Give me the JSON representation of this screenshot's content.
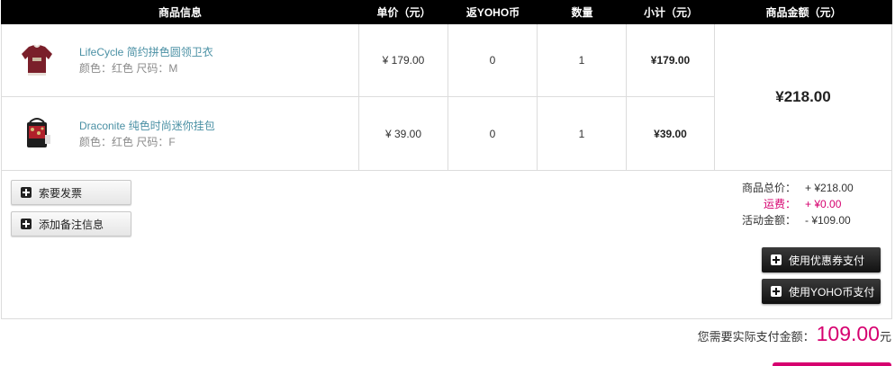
{
  "header": {
    "info": "商品信息",
    "price": "单价（元）",
    "coin": "返YOHO币",
    "qty": "数量",
    "subtotal": "小计（元）",
    "amount": "商品金额（元）"
  },
  "items": [
    {
      "title": "LifeCycle 简约拼色圆领卫衣",
      "attr": "颜色：红色 尺码：M",
      "price": "¥ 179.00",
      "coin": "0",
      "qty": "1",
      "subtotal": "¥179.00",
      "thumb_color": "#7a1f2a"
    },
    {
      "title": "Draconite 纯色时尚迷你挂包",
      "attr": "颜色：红色 尺码：F",
      "price": "¥ 39.00",
      "coin": "0",
      "qty": "1",
      "subtotal": "¥39.00",
      "thumb_color": "#b0202a"
    }
  ],
  "goods_amount": "¥218.00",
  "actions": {
    "invoice": "索要发票",
    "remark": "添加备注信息",
    "coupon": "使用优惠券支付",
    "yoho_coin": "使用YOHO币支付"
  },
  "summary": {
    "goods_total_label": "商品总价：",
    "goods_total_value": "+ ¥218.00",
    "shipping_label": "运费：",
    "shipping_value": "+ ¥0.00",
    "discount_label": "活动金额：",
    "discount_value": "- ¥109.00"
  },
  "pay": {
    "label": "您需要实际支付金额：",
    "amount": "109.00",
    "unit": "元"
  },
  "colors": {
    "accent": "#d6006f",
    "link": "#4a90a4"
  }
}
